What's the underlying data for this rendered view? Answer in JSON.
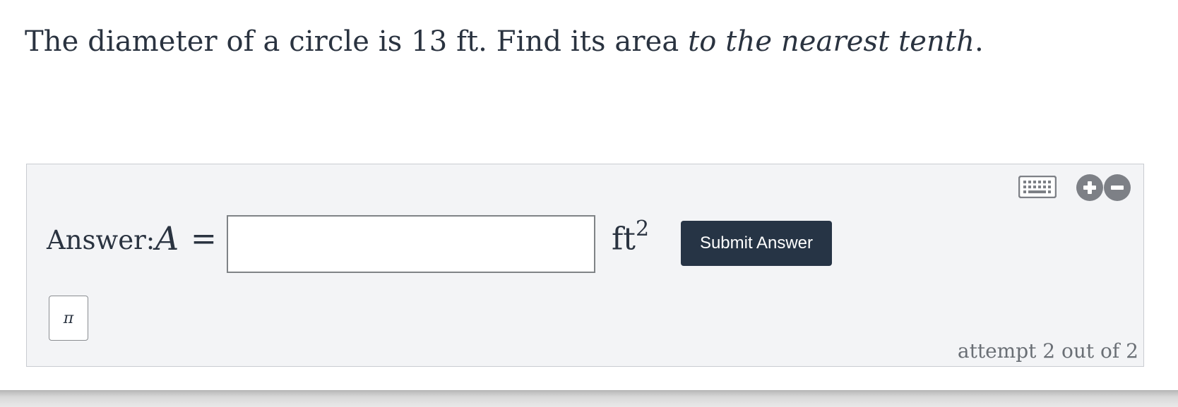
{
  "question": {
    "text_main": "The diameter of a circle is 13 ft. Find its area ",
    "text_emphasis": "to the nearest tenth",
    "text_end": "."
  },
  "answer": {
    "label": "Answer:",
    "variable": "A",
    "equals": "=",
    "input_value": "",
    "unit": "ft",
    "unit_exponent": "2",
    "submit_label": "Submit Answer"
  },
  "tools": {
    "keyboard_icon": "keyboard-icon",
    "zoom_in_icon": "plus-circle-icon",
    "zoom_out_icon": "minus-circle-icon",
    "pi_symbol": "π"
  },
  "status": {
    "attempt_text": "attempt 2 out of 2"
  },
  "colors": {
    "text": "#2a3340",
    "button": "#263445",
    "panel": "#f3f4f6",
    "icon": "#7d8086"
  }
}
